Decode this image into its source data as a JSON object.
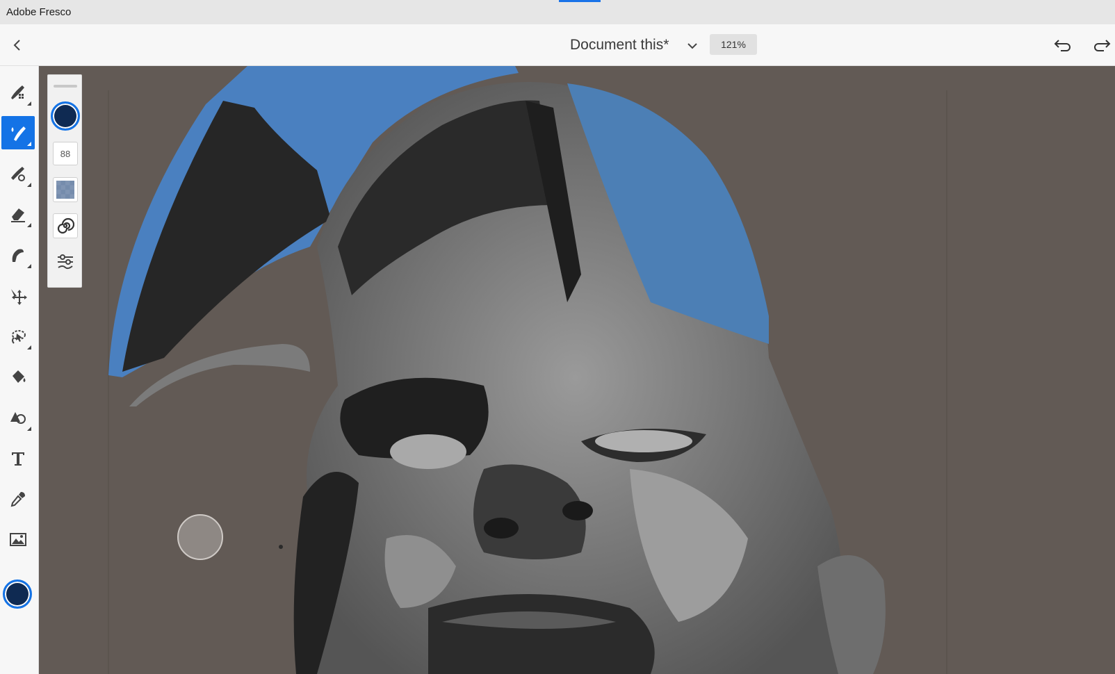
{
  "window": {
    "app_title": "Adobe Fresco"
  },
  "appbar": {
    "document_title": "Document this*",
    "zoom_level": "121%"
  },
  "toolbar": {
    "tools": [
      {
        "name": "pixel-brush",
        "icon": "pixel-brush-icon"
      },
      {
        "name": "live-brush",
        "icon": "live-brush-icon",
        "active": true
      },
      {
        "name": "vector-brush",
        "icon": "vector-brush-icon"
      },
      {
        "name": "eraser",
        "icon": "eraser-icon"
      },
      {
        "name": "smudge",
        "icon": "smudge-icon"
      },
      {
        "name": "move-transform",
        "icon": "move-icon"
      },
      {
        "name": "selection",
        "icon": "lasso-icon"
      },
      {
        "name": "fill",
        "icon": "paint-bucket-icon"
      },
      {
        "name": "shapes",
        "icon": "shapes-icon"
      },
      {
        "name": "type",
        "icon": "type-icon"
      },
      {
        "name": "eyedropper",
        "icon": "eyedropper-icon"
      },
      {
        "name": "place-image",
        "icon": "image-icon"
      }
    ],
    "current_color": "#0f2a52"
  },
  "brush_properties": {
    "color": "#0f2a52",
    "size": "88"
  },
  "colors": {
    "accent": "#1473e6",
    "canvas_bg": "#625a55",
    "paint_blue": "#4a86c8"
  }
}
